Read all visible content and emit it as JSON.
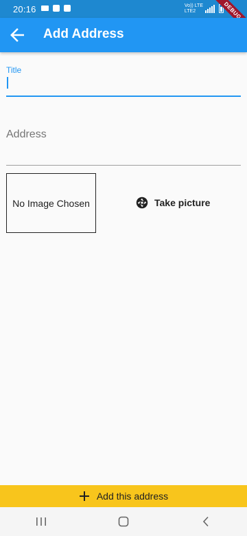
{
  "status_bar": {
    "time": "20:16",
    "network_top": "Vo)) LTE",
    "network_bottom": "LTE2",
    "icons": [
      "video-call-icon",
      "checkbox-icon",
      "chat-icon",
      "signal-icon",
      "battery-icon"
    ]
  },
  "debug_banner": "DEBUG",
  "app_bar": {
    "title": "Add Address",
    "back_icon": "arrow-left-icon"
  },
  "form": {
    "title_label": "Title",
    "title_value": "",
    "address_label": "Address",
    "address_value": ""
  },
  "image_preview": {
    "text": "No Image Chosen"
  },
  "take_picture": {
    "label": "Take picture",
    "icon": "camera-shutter-icon"
  },
  "submit": {
    "label": "Add this address",
    "icon": "plus-icon"
  },
  "nav_bar": {
    "items": [
      "recent-apps-icon",
      "home-icon",
      "back-icon"
    ]
  },
  "colors": {
    "primary": "#2196f3",
    "status_bar": "#1e88d0",
    "accent_button": "#f8c51c",
    "background": "#fafafa"
  }
}
